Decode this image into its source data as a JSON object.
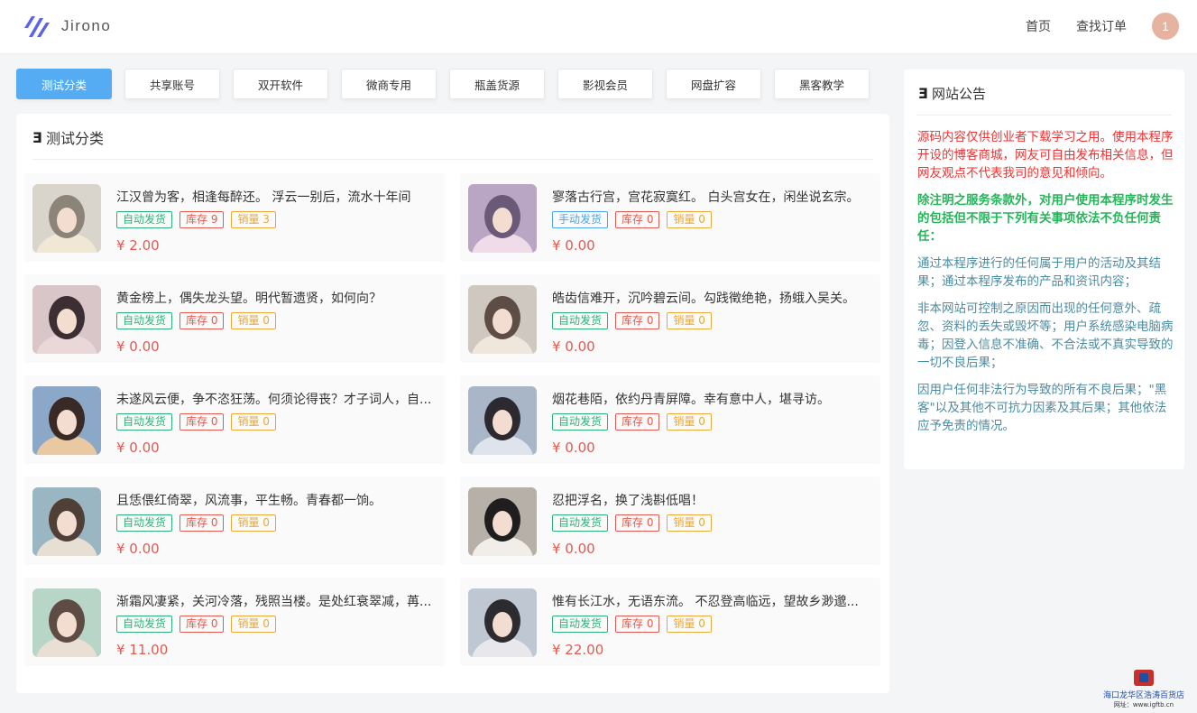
{
  "navbar": {
    "brand": "Jirono",
    "links": [
      "首页",
      "查找订单"
    ],
    "avatar_text": "1"
  },
  "tabs": [
    "测试分类",
    "共享账号",
    "双开软件",
    "微商专用",
    "瓶盖货源",
    "影视会员",
    "网盘扩容",
    "黑客教学"
  ],
  "active_tab": "测试分类",
  "panel": {
    "title": "测试分类"
  },
  "products": [
    {
      "title": "江汉曾为客，相逢每醉还。 浮云一别后，流水十年间",
      "delivery": "自动发货",
      "delivery_type": "auto",
      "stock": "库存 9",
      "sales": "销量 3",
      "price": "¥ 2.00"
    },
    {
      "title": "寥落古行宫，宫花寂寞红。 白头宫女在，闲坐说玄宗。",
      "delivery": "手动发货",
      "delivery_type": "manual",
      "stock": "库存 0",
      "sales": "销量 0",
      "price": "¥ 0.00"
    },
    {
      "title": "黄金榜上，偶失龙头望。明代暂遗贤，如何向？",
      "delivery": "自动发货",
      "delivery_type": "auto",
      "stock": "库存 0",
      "sales": "销量 0",
      "price": "¥ 0.00"
    },
    {
      "title": "皓齿信难开，沉吟碧云间。勾践徵绝艳，扬蛾入吴关。",
      "delivery": "自动发货",
      "delivery_type": "auto",
      "stock": "库存 0",
      "sales": "销量 0",
      "price": "¥ 0.00"
    },
    {
      "title": "未遂风云便，争不恣狂荡。何须论得丧？才子词人，自...",
      "delivery": "自动发货",
      "delivery_type": "auto",
      "stock": "库存 0",
      "sales": "销量 0",
      "price": "¥ 0.00"
    },
    {
      "title": "烟花巷陌，依约丹青屏障。幸有意中人，堪寻访。",
      "delivery": "自动发货",
      "delivery_type": "auto",
      "stock": "库存 0",
      "sales": "销量 0",
      "price": "¥ 0.00"
    },
    {
      "title": "且恁偎红倚翠，风流事，平生畅。青春都一饷。",
      "delivery": "自动发货",
      "delivery_type": "auto",
      "stock": "库存 0",
      "sales": "销量 0",
      "price": "¥ 0.00"
    },
    {
      "title": "忍把浮名，换了浅斟低唱！",
      "delivery": "自动发货",
      "delivery_type": "auto",
      "stock": "库存 0",
      "sales": "销量 0",
      "price": "¥ 0.00"
    },
    {
      "title": "渐霜风凄紧，关河冷落，残照当楼。是处红衰翠减，苒...",
      "delivery": "自动发货",
      "delivery_type": "auto",
      "stock": "库存 0",
      "sales": "销量 0",
      "price": "¥ 11.00"
    },
    {
      "title": "惟有长江水，无语东流。 不忍登高临远，望故乡渺邈...",
      "delivery": "自动发货",
      "delivery_type": "auto",
      "stock": "库存 0",
      "sales": "销量 0",
      "price": "¥ 22.00"
    }
  ],
  "notice": {
    "title": "网站公告",
    "p1": "源码内容仅供创业者下载学习之用。使用本程序开设的博客商城，网友可自由发布相关信息，但网友观点不代表我司的意见和倾向。",
    "p2": "除注明之服务条款外，对用户使用本程序时发生的包括但不限于下列有关事项依法不负任何责任：",
    "p3": "通过本程序进行的任何属于用户的活动及其结果；通过本程序发布的产品和资讯内容；",
    "p4": "非本网站可控制之原因而出现的任何意外、疏忽、资料的丢失或毁坏等；用户系统感染电脑病毒；因登入信息不准确、不合法或不真实导致的一切不良后果；",
    "p5": "因用户任何非法行为导致的所有不良后果；\"黑客\"以及其他不可抗力因素及其后果；其他依法应予免责的情况。"
  },
  "watermark": {
    "line1": "海口龙华区浩涛百货店",
    "line2": "网址：www.igftb.cn"
  },
  "colors": {
    "accent": "#55acf3",
    "price": "#e25a4f",
    "badge_auto": "#2fb27a",
    "badge_manual": "#4ea5e9",
    "badge_stock": "#e25a4f",
    "badge_sales": "#e9a83a",
    "notice_red": "#ec3232",
    "notice_green": "#26b55b",
    "notice_teal": "#4b8ba0"
  }
}
